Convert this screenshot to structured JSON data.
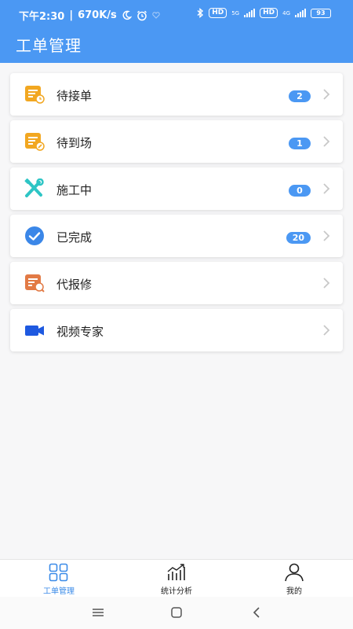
{
  "status_bar": {
    "time": "下午2:30",
    "speed": "670K/s",
    "network_badge_1": "HD",
    "network_badge_2": "HD",
    "signal_label_1": "5G",
    "signal_label_2": "4G",
    "battery": "93"
  },
  "header": {
    "title": "工单管理"
  },
  "menu": [
    {
      "label": "待接单",
      "badge": "2",
      "icon": "pending-accept-icon",
      "color": "#f2a721"
    },
    {
      "label": "待到场",
      "badge": "1",
      "icon": "pending-arrival-icon",
      "color": "#f2a721"
    },
    {
      "label": "施工中",
      "badge": "0",
      "icon": "tools-icon",
      "color": "#2ec5c5"
    },
    {
      "label": "已完成",
      "badge": "20",
      "icon": "check-circle-icon",
      "color": "#3b87e8"
    },
    {
      "label": "代报修",
      "badge": "",
      "icon": "repair-report-icon",
      "color": "#e27a45"
    },
    {
      "label": "视频专家",
      "badge": "",
      "icon": "video-camera-icon",
      "color": "#1e59e0"
    }
  ],
  "tabbar": {
    "tabs": [
      {
        "label": "工单管理",
        "icon": "grid-icon",
        "active": true
      },
      {
        "label": "统计分析",
        "icon": "chart-icon",
        "active": false
      },
      {
        "label": "我的",
        "icon": "user-icon",
        "active": false
      }
    ]
  },
  "colors": {
    "accent": "#4b98f3",
    "badge": "#4b98f3"
  }
}
